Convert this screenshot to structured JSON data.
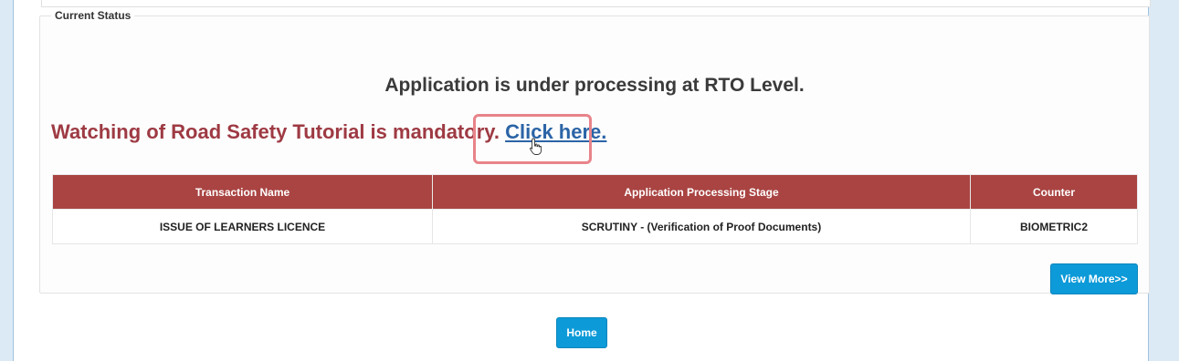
{
  "fieldset": {
    "legend": "Current Status"
  },
  "status": {
    "headline": "Application is under processing at RTO Level.",
    "notice_text": "Watching of Road Safety Tutorial is mandatory.",
    "notice_link": "Click here."
  },
  "table": {
    "headers": [
      "Transaction Name",
      "Application Processing Stage",
      "Counter"
    ],
    "rows": [
      [
        "ISSUE OF LEARNERS LICENCE",
        "SCRUTINY - (Verification of Proof Documents)",
        "BIOMETRIC2"
      ]
    ]
  },
  "buttons": {
    "view_more": "View More>>",
    "home": "Home"
  },
  "colors": {
    "header_bg": "#a94442",
    "notice": "#9e3a43",
    "link": "#2b64a6",
    "button": "#0d9ad8",
    "highlight": "#e8848a"
  }
}
